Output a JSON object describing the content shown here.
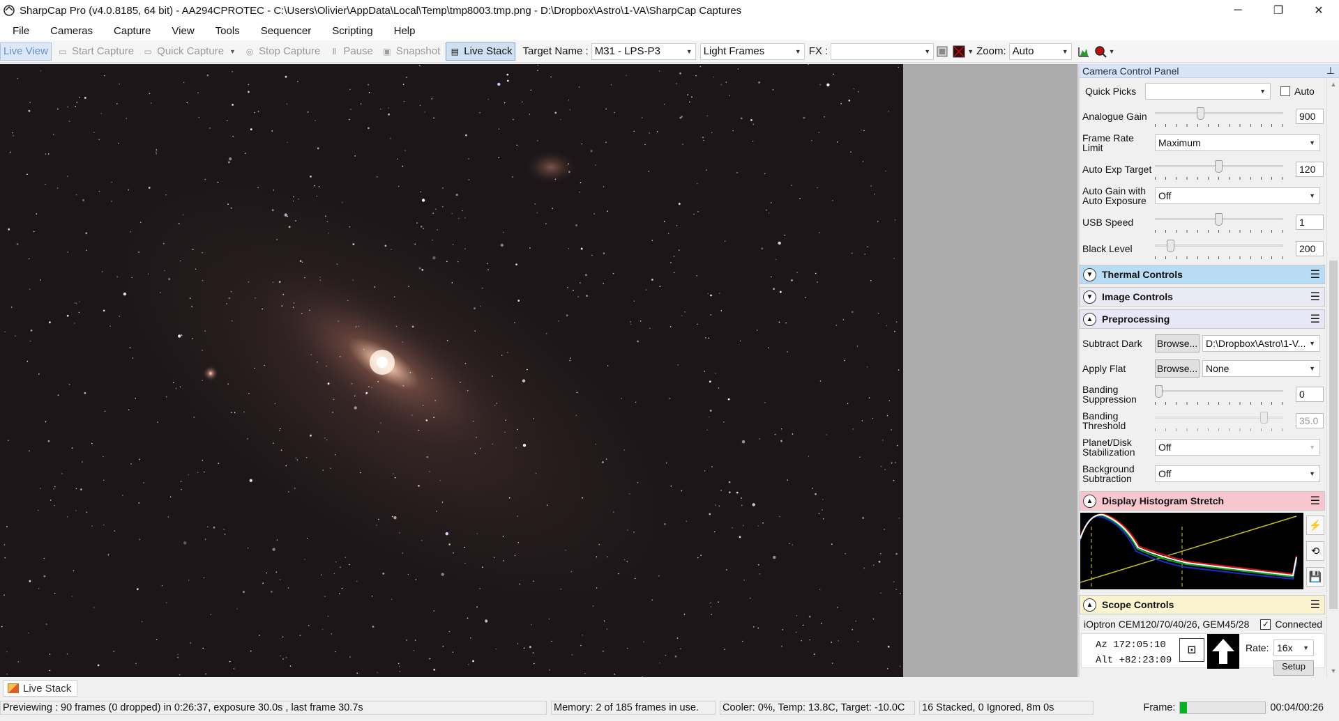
{
  "window": {
    "title": "SharpCap Pro (v4.0.8185, 64 bit) - AA294CPROTEC - C:\\Users\\Olivier\\AppData\\Local\\Temp\\tmp8003.tmp.png - D:\\Dropbox\\Astro\\1-VA\\SharpCap Captures",
    "minimize": "─",
    "restore": "❐",
    "close": "✕"
  },
  "menu": [
    "File",
    "Cameras",
    "Capture",
    "View",
    "Tools",
    "Sequencer",
    "Scripting",
    "Help"
  ],
  "toolbar": {
    "live_view": "Live View",
    "start_capture": "Start Capture",
    "quick_capture": "Quick Capture",
    "stop_capture": "Stop Capture",
    "pause": "Pause",
    "snapshot": "Snapshot",
    "live_stack": "Live Stack",
    "target_name_label": "Target Name :",
    "target_name_value": "M31 - LPS-P3",
    "frame_type": "Light Frames",
    "fx_label": "FX :",
    "fx_value": "",
    "zoom_label": "Zoom:",
    "zoom_value": "Auto"
  },
  "panel": {
    "title": "Camera Control Panel",
    "pin": "⊥",
    "quick_picks_label": "Quick Picks",
    "quick_picks_value": "",
    "auto_label": "Auto",
    "auto_checked": false,
    "analogue_gain": {
      "label": "Analogue Gain",
      "value": "900",
      "level": 0.35
    },
    "frame_rate_limit": {
      "label": "Frame Rate Limit",
      "value": "Maximum"
    },
    "auto_exp_target": {
      "label": "Auto Exp Target",
      "value": "120",
      "level": 0.5
    },
    "auto_gain": {
      "label": "Auto Gain with Auto Exposure",
      "value": "Off"
    },
    "usb_speed": {
      "label": "USB Speed",
      "value": "1",
      "level": 0.5
    },
    "black_level": {
      "label": "Black Level",
      "value": "200",
      "level": 0.1
    },
    "sections": {
      "thermal": "Thermal Controls",
      "image": "Image Controls",
      "preprocessing": "Preprocessing",
      "histogram": "Display Histogram Stretch",
      "scope": "Scope Controls"
    },
    "subtract_dark": {
      "label": "Subtract Dark",
      "browse": "Browse...",
      "value": "D:\\Dropbox\\Astro\\1-V..."
    },
    "apply_flat": {
      "label": "Apply Flat",
      "browse": "Browse...",
      "value": "None"
    },
    "banding_suppression": {
      "label": "Banding Suppression",
      "value": "0",
      "level": 0.0
    },
    "banding_threshold": {
      "label": "Banding Threshold",
      "value": "35.0",
      "level": 0.88
    },
    "planet_disk": {
      "label": "Planet/Disk Stabilization",
      "value": "Off"
    },
    "background_subtraction": {
      "label": "Background Subtraction",
      "value": "Off"
    },
    "scope": {
      "mount": "iOptron CEM120/70/40/26, GEM45/28",
      "connected_label": "Connected",
      "connected": true,
      "az": "Az  172:05:10",
      "alt": "Alt +82:23:09",
      "rate_label": "Rate:",
      "rate_value": "16x",
      "setup": "Setup"
    }
  },
  "bottom_tab": "Live Stack",
  "status": {
    "previewing": "Previewing : 90 frames (0 dropped) in 0:26:37, exposure 30.0s , last frame 30.7s",
    "memory": "Memory: 2 of 185 frames in use.",
    "cooler": "Cooler: 0%, Temp: 13.8C, Target: -10.0C",
    "stacked": "16 Stacked, 0 Ignored, 8m 0s",
    "frame_label": "Frame:",
    "frame_progress": 0.08,
    "time": "00:04/00:26"
  },
  "colors": {
    "accent": "#cfe0f3",
    "thermal_header": "#b9dcf5",
    "image_header": "#eaeaf5",
    "preprocessing_header": "#e7e7f7",
    "histogram_header": "#f7c6ce",
    "scope_header": "#fbf3cf",
    "frame_fill": "#06b025"
  }
}
